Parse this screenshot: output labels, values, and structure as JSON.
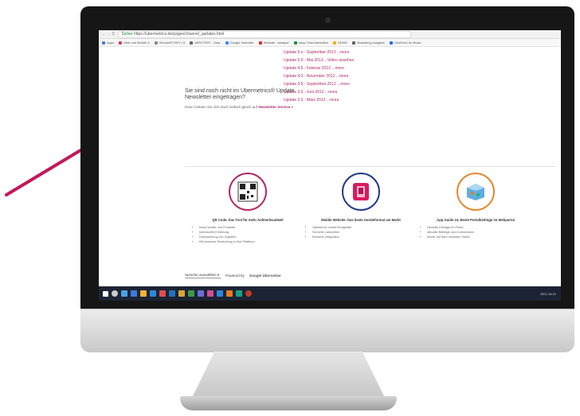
{
  "browser": {
    "nav": "← → C",
    "secure_label": "Sicher",
    "url": "https://ubermetrics.de/pages/channel_updates.html",
    "bookmarks": [
      {
        "label": "Apps",
        "color": "#4a7bd4"
      },
      {
        "label": "Web und Mobile S",
        "color": "#d23b6d"
      },
      {
        "label": "SchnellSTORY | S",
        "color": "#888888"
      },
      {
        "label": "AIRSTORY - Sear",
        "color": "#666666"
      },
      {
        "label": "Google Kalender",
        "color": "#4285f4"
      },
      {
        "label": "Website - Analyse",
        "color": "#d93025"
      },
      {
        "label": "easy: Dokumentation",
        "color": "#1e8e3e"
      },
      {
        "label": "DEMO",
        "color": "#f4b400"
      },
      {
        "label": "Marketing-Ausgabe",
        "color": "#5f6368"
      },
      {
        "label": "OneDrive for Busin",
        "color": "#1a73e8"
      }
    ]
  },
  "updates": [
    "Update 5.x - September 2013 ...more",
    "Update 5.0 - Mai 2013 ...Video ansehen",
    "Update 4.5 - Februar 2013 ...more",
    "Update 4.0 - November 2012 ...more",
    "Update 3.5 - September 2012 ...more",
    "Update 3.0 - Juni 2012 ...more",
    "Update 2.0 - März 2012 ...more"
  ],
  "newsletter": {
    "title": "Sie sind noch nicht im Ubermetrics® Update Newsletter eingetragen?",
    "text": "Dann melden Sie sich doch einfach gleich auf",
    "link": "Newsletter Service »"
  },
  "features": [
    {
      "title": "QR Code. Das Tool für mehr Aufmerksamkeit",
      "items": [
        "Neue Inhalte und Produkte",
        "Individuelle Erstellung",
        "Überwachung von Zugriffen",
        "Mit einfacher Einbindung in Ihre Plattform"
      ]
    },
    {
      "title": "Mobile Website. Das beste Geräteformat am Markt",
      "items": [
        "Optimal für mobile Endgeräte",
        "Schnelle Ladezeiten",
        "Einfache Integration"
      ]
    },
    {
      "title": "App Guide 24. Beste Portalbeiträge im Webportal",
      "items": [
        "Neueste Einträge im Portal",
        "Aktuelle Beiträge und Kommentare",
        "Immer auf dem neuesten Stand"
      ]
    }
  ],
  "language": {
    "label": "Sprache auswählen",
    "powered": "Powered by",
    "brand": "Google Übersetzer"
  },
  "taskbar": {
    "icons": [
      "#ffffff",
      "#cccccc",
      "#4aa0e6",
      "#3d7bd9",
      "#f2b233",
      "#2a8ad8",
      "#e04d4d",
      "#1e73be",
      "#d9a536",
      "#3a9b4b",
      "#6c6cd9",
      "#d04e8f",
      "#2e86de",
      "#e67e22",
      "#16a085",
      "#c0392b"
    ],
    "tray": "DEU 14:21"
  },
  "colors": {
    "accent": "#b02a6b",
    "arrow": "#c2185b",
    "taskbar": "#1c2333"
  }
}
